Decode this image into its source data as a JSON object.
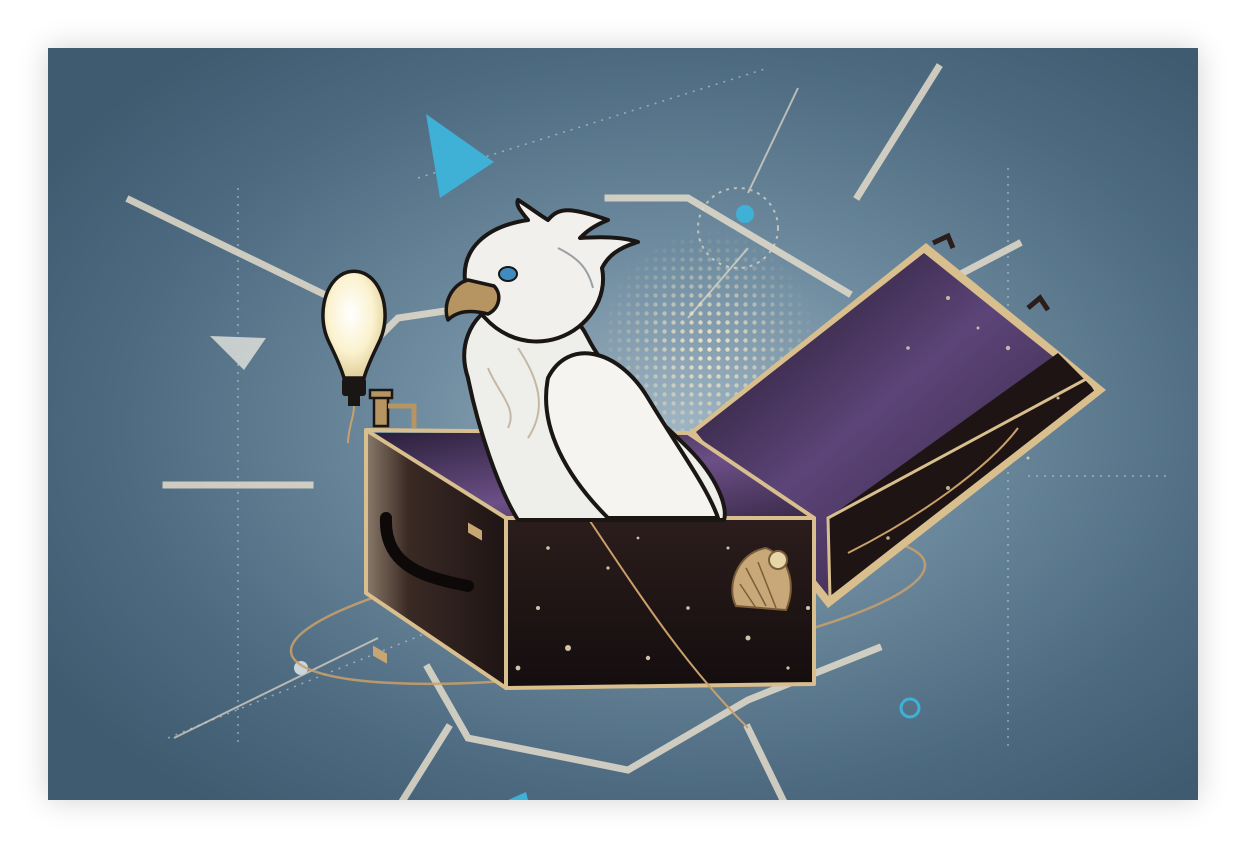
{
  "image": {
    "subject": "white-griffin-in-open-case",
    "colors": {
      "background": "#4d6a80",
      "background_light": "#7f9aab",
      "accent_cyan": "#3fb0d6",
      "line_cream": "#e4dccb",
      "case_dark": "#1e1414",
      "case_trim": "#d9bf8e",
      "case_interior": "#6b4f86",
      "bird_white": "#eeeeea",
      "beak": "#b69562",
      "bulb": "#fbf2cf",
      "halftone": "#f2e7c6"
    }
  }
}
